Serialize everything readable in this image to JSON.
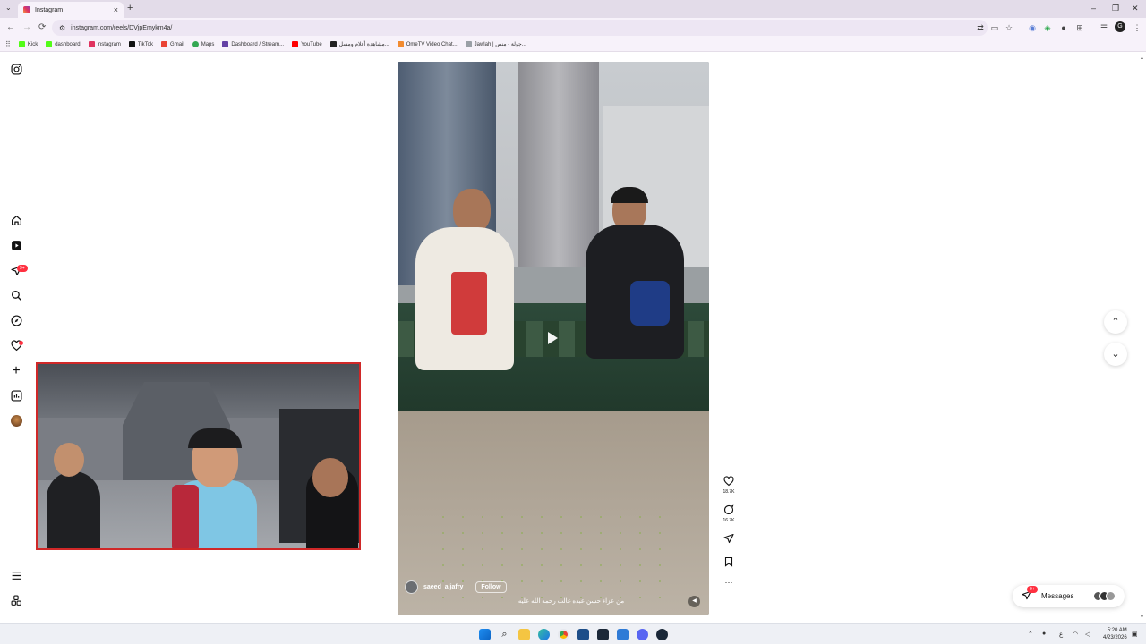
{
  "browser": {
    "tab_title": "Instagram",
    "tab_close": "×",
    "new_tab": "+",
    "url": "instagram.com/reels/DVjpEmykm4a/",
    "profile_initial": "G",
    "window_controls": [
      "–",
      "❐",
      "✕"
    ]
  },
  "bookmarks": [
    {
      "label": "Kick",
      "color": "#53fc18"
    },
    {
      "label": "dashboard",
      "color": "#53fc18"
    },
    {
      "label": "instagram",
      "color": "#e0335f"
    },
    {
      "label": "TikTok",
      "color": "#111111"
    },
    {
      "label": "Gmail",
      "color": "#ea4335"
    },
    {
      "label": "Maps",
      "color": "#34a853"
    },
    {
      "label": "Dashboard / Stream...",
      "color": "#6441a5"
    },
    {
      "label": "YouTube",
      "color": "#ff0000"
    },
    {
      "label": "مشاهدة أفلام ومسل...",
      "color": "#222222"
    },
    {
      "label": "OmeTV Video Chat...",
      "color": "#f28b30"
    },
    {
      "label": "Jawlah | جولة - منص...",
      "color": "#9aa0a6"
    }
  ],
  "sidebar": {
    "notifications_badge": "9+",
    "icons": [
      "instagram-icon",
      "home-icon",
      "reels-icon",
      "messages-icon",
      "search-icon",
      "explore-icon",
      "notifications-icon",
      "create-icon",
      "dashboard-icon",
      "profile-avatar",
      "menu-icon",
      "threads-icon"
    ]
  },
  "reel": {
    "username": "saeed_aljafry",
    "follow_label": "Follow",
    "caption": "من عزاء حسن عبده غالب رحمه الله عليه",
    "likes": "18.7K",
    "comments": "16.7K",
    "more": "···"
  },
  "messages": {
    "label": "Messages",
    "badge": "9+"
  },
  "taskbar": {
    "time": "5:20 AM",
    "date": "4/23/2026",
    "lang": "ع"
  },
  "colors": {
    "accent": "#ff3040",
    "cam_border": "#d02828"
  }
}
